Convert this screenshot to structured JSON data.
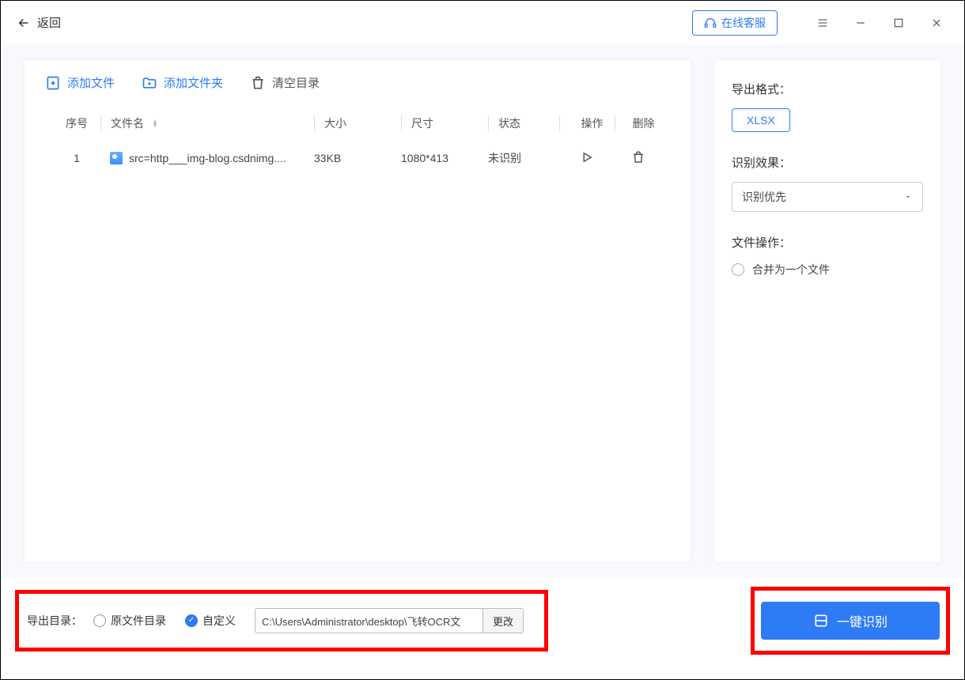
{
  "titlebar": {
    "back": "返回",
    "online_service": "在线客服"
  },
  "toolbar": {
    "add_file": "添加文件",
    "add_folder": "添加文件夹",
    "clear_all": "清空目录"
  },
  "table": {
    "headers": {
      "seq": "序号",
      "name": "文件名",
      "size": "大小",
      "dimensions": "尺寸",
      "status": "状态",
      "operate": "操作",
      "delete": "删除"
    },
    "rows": [
      {
        "seq": "1",
        "name": "src=http___img-blog.csdnimg....",
        "size": "33KB",
        "dimensions": "1080*413",
        "status": "未识别"
      }
    ]
  },
  "side": {
    "export_format_label": "导出格式：",
    "export_format_value": "XLSX",
    "effect_label": "识别效果：",
    "effect_value": "识别优先",
    "file_op_label": "文件操作：",
    "merge_option": "合并为一个文件"
  },
  "footer": {
    "export_dir_label": "导出目录：",
    "original_dir": "原文件目录",
    "custom": "自定义",
    "path": "C:\\Users\\Administrator\\desktop\\飞转OCR文",
    "change": "更改",
    "recognize": "一键识别"
  }
}
